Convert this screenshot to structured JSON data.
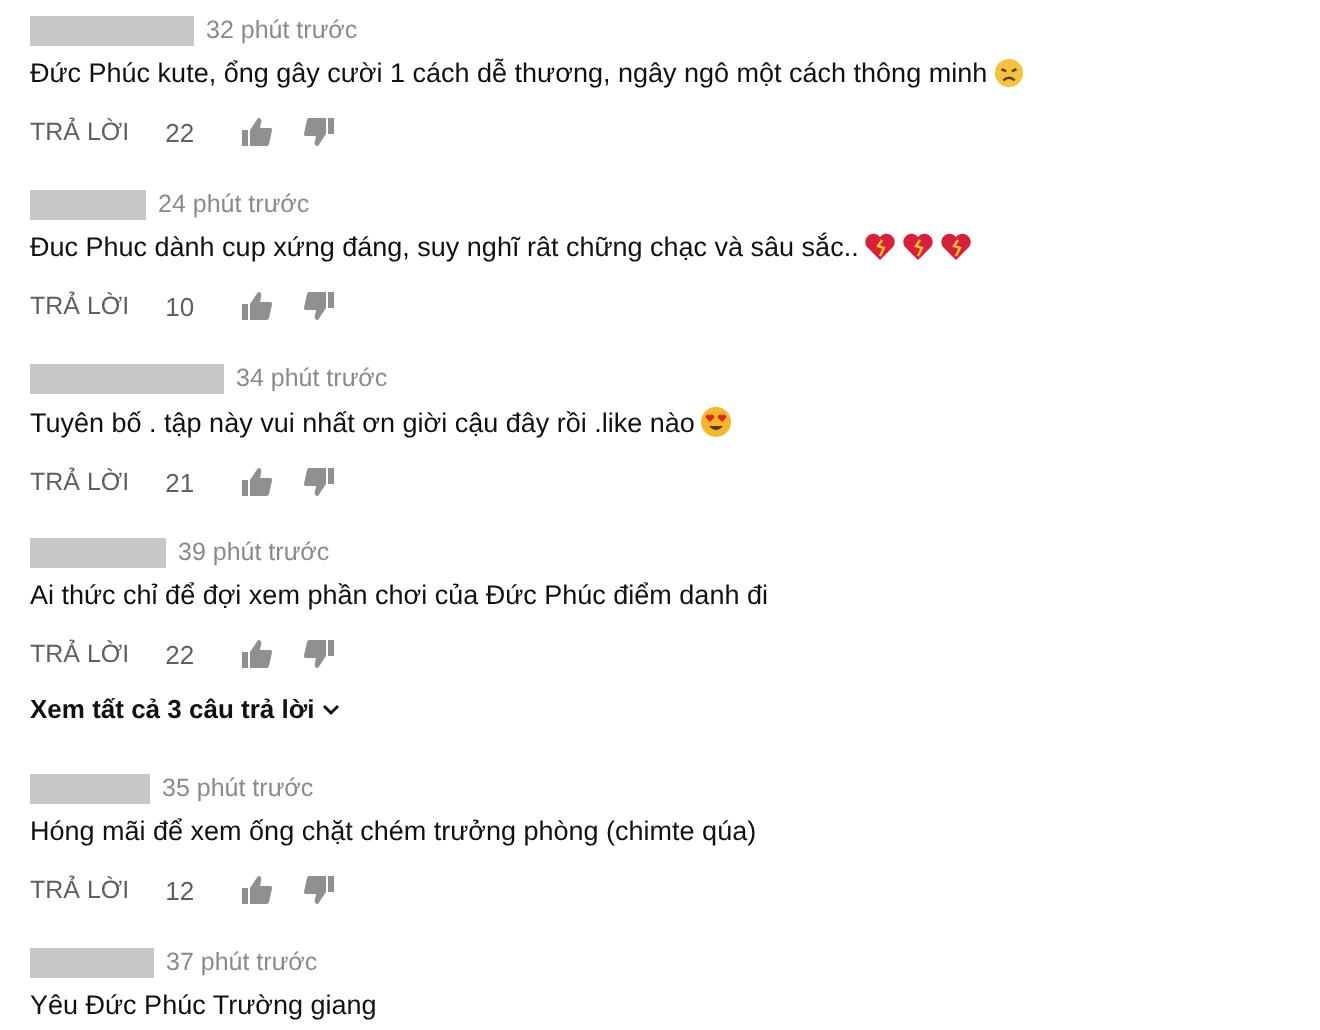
{
  "comments": [
    {
      "time": "32 phút trước",
      "text": "Đức Phúc kute, ổng gây cười 1 cách dễ thương, ngây ngô một cách thông minh",
      "emojis": [
        {
          "kind": "weary"
        }
      ],
      "reply": "TRẢ LỜI",
      "likes": "22"
    },
    {
      "time": "24 phút trước",
      "text": "Đuc Phuc dành cup xứng đáng, suy nghĩ rât chững chạc và sâu sắc..",
      "emojis": [
        {
          "kind": "heart"
        },
        {
          "kind": "heart"
        },
        {
          "kind": "heart"
        }
      ],
      "reply": "TRẢ LỜI",
      "likes": "10"
    },
    {
      "time": "34 phút trước",
      "text": "Tuyên bố . tập này vui nhất ơn giời cậu đây rồi .like nào",
      "emojis": [
        {
          "kind": "heart-eyes"
        }
      ],
      "reply": "TRẢ LỜI",
      "likes": "21"
    },
    {
      "time": "39 phút trước",
      "text": "Ai thức chỉ để đợi xem phần chơi của Đức Phúc điểm danh đi",
      "reply": "TRẢ LỜI",
      "likes": "22",
      "view_replies": "Xem tất cả 3 câu trả lời"
    },
    {
      "time": "35 phút trước",
      "text": "Hóng mãi để xem ống chặt chém trưởng phòng (chimte qúa)",
      "reply": "TRẢ LỜI",
      "likes": "12"
    },
    {
      "time": "37 phút trước",
      "text": "Yêu Đức Phúc Trường giang"
    }
  ]
}
